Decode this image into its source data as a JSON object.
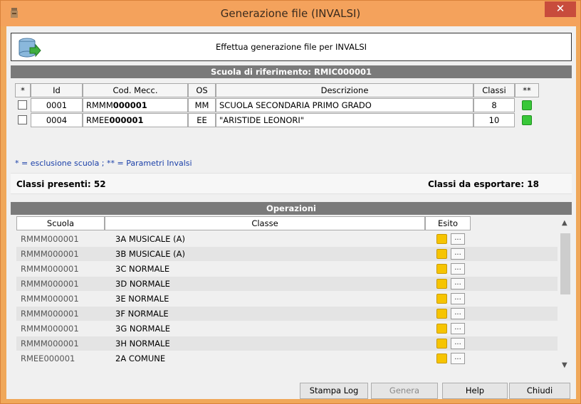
{
  "window": {
    "title": "Generazione file (INVALSI)",
    "close_label": "✕"
  },
  "header": {
    "text": "Effettua generazione file per INVALSI"
  },
  "school_section": {
    "title": "Scuola di riferimento: RMIC000001",
    "columns": [
      "*",
      "Id",
      "Cod. Mecc.",
      "OS",
      "Descrizione",
      "Classi",
      "**"
    ],
    "rows": [
      {
        "id": "0001",
        "code_prefix": "RMMM",
        "code_suffix": "000001",
        "os": "MM",
        "description": "SCUOLA SECONDARIA PRIMO GRADO",
        "classes": "8"
      },
      {
        "id": "0004",
        "code_prefix": "RMEE",
        "code_suffix": "000001",
        "os": "EE",
        "description": "\"ARISTIDE LEONORI\"",
        "classes": "10"
      }
    ],
    "legend": "* = esclusione scuola ; ** = Parametri Invalsi"
  },
  "stats": {
    "present": "Classi presenti: 52",
    "to_export": "Classi da esportare: 18"
  },
  "operations": {
    "title": "Operazioni",
    "columns": [
      "Scuola",
      "Classe",
      "Esito"
    ],
    "rows": [
      {
        "school": "RMMM000001",
        "class": "3A MUSICALE (A)"
      },
      {
        "school": "RMMM000001",
        "class": "3B MUSICALE (A)"
      },
      {
        "school": "RMMM000001",
        "class": "3C NORMALE"
      },
      {
        "school": "RMMM000001",
        "class": "3D NORMALE"
      },
      {
        "school": "RMMM000001",
        "class": "3E NORMALE"
      },
      {
        "school": "RMMM000001",
        "class": "3F NORMALE"
      },
      {
        "school": "RMMM000001",
        "class": "3G NORMALE"
      },
      {
        "school": "RMMM000001",
        "class": "3H NORMALE"
      },
      {
        "school": "RMEE000001",
        "class": "2A COMUNE"
      }
    ],
    "result_button": "..."
  },
  "buttons": {
    "log": "Stampa Log",
    "generate": "Genera",
    "help": "Help",
    "close": "Chiudi"
  },
  "colors": {
    "titlebar": "#f4a25c",
    "close": "#c84c3c",
    "section_bar": "#7a7a7a",
    "status_green": "#39c739",
    "status_yellow": "#f6c400",
    "legend_text": "#1a3fa8"
  }
}
